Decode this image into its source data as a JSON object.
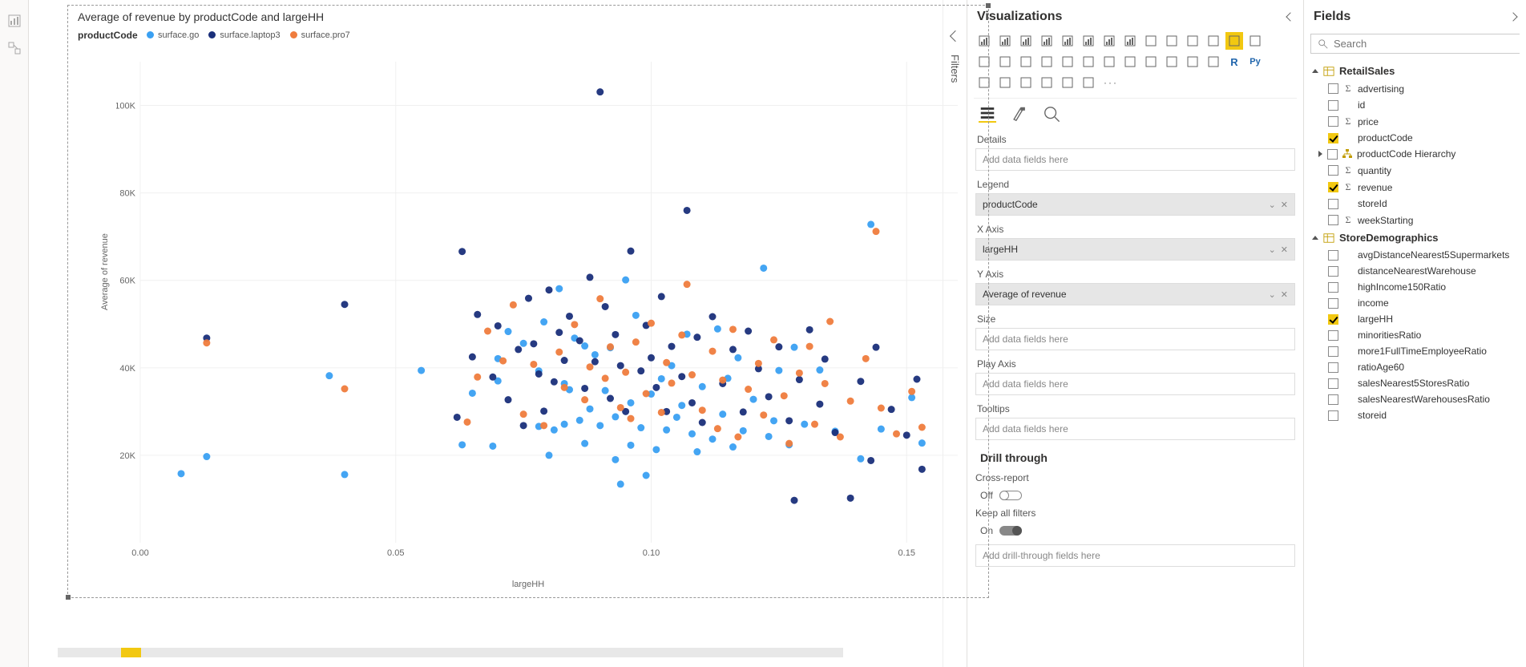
{
  "left_rail": {
    "icons": [
      "report-view-icon",
      "model-view-icon"
    ]
  },
  "filters_rail": {
    "label": "Filters"
  },
  "chart_data": {
    "type": "scatter",
    "title": "Average of revenue by productCode and largeHH",
    "legend_title": "productCode",
    "xlabel": "largeHH",
    "ylabel": "Average of revenue",
    "xlim": [
      0.0,
      0.16
    ],
    "ylim": [
      0,
      110000
    ],
    "xticks": [
      0.0,
      0.05,
      0.1,
      0.15
    ],
    "yticks": [
      20000,
      40000,
      60000,
      80000,
      100000
    ],
    "ytick_labels": [
      "20K",
      "40K",
      "60K",
      "80K",
      "100K"
    ],
    "series": [
      {
        "name": "surface.go",
        "color": "#3aa0f2",
        "points": [
          [
            0.008,
            15800
          ],
          [
            0.013,
            19700
          ],
          [
            0.04,
            15600
          ],
          [
            0.037,
            38200
          ],
          [
            0.055,
            39400
          ],
          [
            0.063,
            22400
          ],
          [
            0.065,
            34200
          ],
          [
            0.069,
            22100
          ],
          [
            0.07,
            37000
          ],
          [
            0.07,
            42100
          ],
          [
            0.072,
            48300
          ],
          [
            0.075,
            45600
          ],
          [
            0.078,
            39300
          ],
          [
            0.078,
            26600
          ],
          [
            0.079,
            50500
          ],
          [
            0.08,
            20000
          ],
          [
            0.081,
            25800
          ],
          [
            0.082,
            58100
          ],
          [
            0.083,
            27100
          ],
          [
            0.083,
            36400
          ],
          [
            0.084,
            35000
          ],
          [
            0.085,
            46800
          ],
          [
            0.086,
            28000
          ],
          [
            0.087,
            22700
          ],
          [
            0.087,
            45000
          ],
          [
            0.088,
            30600
          ],
          [
            0.089,
            43000
          ],
          [
            0.09,
            26800
          ],
          [
            0.091,
            34800
          ],
          [
            0.092,
            44600
          ],
          [
            0.093,
            28800
          ],
          [
            0.093,
            19000
          ],
          [
            0.094,
            13400
          ],
          [
            0.095,
            60100
          ],
          [
            0.096,
            32000
          ],
          [
            0.096,
            22300
          ],
          [
            0.097,
            52000
          ],
          [
            0.098,
            26300
          ],
          [
            0.099,
            15400
          ],
          [
            0.1,
            34000
          ],
          [
            0.101,
            21300
          ],
          [
            0.102,
            37500
          ],
          [
            0.103,
            25800
          ],
          [
            0.104,
            40500
          ],
          [
            0.105,
            28700
          ],
          [
            0.106,
            31400
          ],
          [
            0.107,
            47700
          ],
          [
            0.108,
            24900
          ],
          [
            0.109,
            20800
          ],
          [
            0.11,
            35700
          ],
          [
            0.112,
            23700
          ],
          [
            0.113,
            48900
          ],
          [
            0.114,
            29400
          ],
          [
            0.115,
            37600
          ],
          [
            0.116,
            21900
          ],
          [
            0.117,
            42300
          ],
          [
            0.118,
            25600
          ],
          [
            0.12,
            32800
          ],
          [
            0.122,
            62800
          ],
          [
            0.123,
            24300
          ],
          [
            0.124,
            27900
          ],
          [
            0.125,
            39400
          ],
          [
            0.127,
            22400
          ],
          [
            0.128,
            44700
          ],
          [
            0.13,
            27100
          ],
          [
            0.133,
            39500
          ],
          [
            0.136,
            25500
          ],
          [
            0.141,
            19200
          ],
          [
            0.143,
            72800
          ],
          [
            0.145,
            26000
          ],
          [
            0.151,
            33200
          ],
          [
            0.153,
            22800
          ]
        ]
      },
      {
        "name": "surface.laptop3",
        "color": "#1a2f7a",
        "points": [
          [
            0.013,
            46800
          ],
          [
            0.04,
            54500
          ],
          [
            0.062,
            28700
          ],
          [
            0.063,
            66600
          ],
          [
            0.065,
            42500
          ],
          [
            0.066,
            52200
          ],
          [
            0.069,
            37900
          ],
          [
            0.07,
            49600
          ],
          [
            0.072,
            32700
          ],
          [
            0.074,
            44200
          ],
          [
            0.075,
            26800
          ],
          [
            0.076,
            55900
          ],
          [
            0.077,
            45500
          ],
          [
            0.078,
            38600
          ],
          [
            0.079,
            30100
          ],
          [
            0.08,
            57800
          ],
          [
            0.081,
            36800
          ],
          [
            0.082,
            48100
          ],
          [
            0.083,
            41700
          ],
          [
            0.084,
            51800
          ],
          [
            0.086,
            46200
          ],
          [
            0.087,
            35300
          ],
          [
            0.088,
            60700
          ],
          [
            0.089,
            41400
          ],
          [
            0.09,
            103100
          ],
          [
            0.091,
            54000
          ],
          [
            0.092,
            33000
          ],
          [
            0.093,
            47600
          ],
          [
            0.094,
            40500
          ],
          [
            0.095,
            30000
          ],
          [
            0.096,
            66700
          ],
          [
            0.098,
            39300
          ],
          [
            0.099,
            49700
          ],
          [
            0.1,
            42300
          ],
          [
            0.101,
            35500
          ],
          [
            0.102,
            56300
          ],
          [
            0.103,
            30000
          ],
          [
            0.104,
            44900
          ],
          [
            0.106,
            38000
          ],
          [
            0.107,
            76000
          ],
          [
            0.108,
            32000
          ],
          [
            0.109,
            47000
          ],
          [
            0.11,
            27500
          ],
          [
            0.112,
            51700
          ],
          [
            0.114,
            36400
          ],
          [
            0.116,
            44200
          ],
          [
            0.118,
            29900
          ],
          [
            0.119,
            48400
          ],
          [
            0.121,
            39800
          ],
          [
            0.123,
            33400
          ],
          [
            0.125,
            44800
          ],
          [
            0.127,
            27900
          ],
          [
            0.128,
            9700
          ],
          [
            0.129,
            37300
          ],
          [
            0.131,
            48700
          ],
          [
            0.133,
            31700
          ],
          [
            0.134,
            42000
          ],
          [
            0.136,
            25200
          ],
          [
            0.139,
            10200
          ],
          [
            0.141,
            36900
          ],
          [
            0.143,
            18800
          ],
          [
            0.144,
            44700
          ],
          [
            0.147,
            30500
          ],
          [
            0.15,
            24600
          ],
          [
            0.152,
            37400
          ],
          [
            0.153,
            16800
          ]
        ]
      },
      {
        "name": "surface.pro7",
        "color": "#ef7c3d",
        "points": [
          [
            0.013,
            45700
          ],
          [
            0.04,
            35200
          ],
          [
            0.064,
            27600
          ],
          [
            0.066,
            37900
          ],
          [
            0.068,
            48400
          ],
          [
            0.071,
            41600
          ],
          [
            0.073,
            54400
          ],
          [
            0.075,
            29400
          ],
          [
            0.077,
            40800
          ],
          [
            0.079,
            26800
          ],
          [
            0.082,
            43600
          ],
          [
            0.083,
            35500
          ],
          [
            0.085,
            49900
          ],
          [
            0.087,
            32700
          ],
          [
            0.088,
            40200
          ],
          [
            0.09,
            55800
          ],
          [
            0.091,
            37600
          ],
          [
            0.092,
            44800
          ],
          [
            0.094,
            30900
          ],
          [
            0.095,
            39000
          ],
          [
            0.096,
            28400
          ],
          [
            0.097,
            45900
          ],
          [
            0.099,
            34100
          ],
          [
            0.1,
            50200
          ],
          [
            0.102,
            29800
          ],
          [
            0.103,
            41200
          ],
          [
            0.104,
            36500
          ],
          [
            0.106,
            47500
          ],
          [
            0.107,
            59100
          ],
          [
            0.108,
            38400
          ],
          [
            0.11,
            30300
          ],
          [
            0.112,
            43800
          ],
          [
            0.113,
            26100
          ],
          [
            0.114,
            37200
          ],
          [
            0.116,
            48800
          ],
          [
            0.117,
            24200
          ],
          [
            0.119,
            35100
          ],
          [
            0.121,
            41000
          ],
          [
            0.122,
            29200
          ],
          [
            0.124,
            46400
          ],
          [
            0.126,
            33600
          ],
          [
            0.127,
            22700
          ],
          [
            0.129,
            38800
          ],
          [
            0.131,
            44900
          ],
          [
            0.132,
            27100
          ],
          [
            0.134,
            36400
          ],
          [
            0.135,
            50600
          ],
          [
            0.137,
            24200
          ],
          [
            0.139,
            32400
          ],
          [
            0.142,
            42100
          ],
          [
            0.144,
            71200
          ],
          [
            0.145,
            30800
          ],
          [
            0.148,
            24900
          ],
          [
            0.151,
            34600
          ],
          [
            0.153,
            26400
          ]
        ]
      }
    ]
  },
  "viz_panel": {
    "title": "Visualizations",
    "selected_icon": "scatter-chart-icon",
    "more": "···",
    "tabs": {
      "fields_tab": "fields",
      "format_tab": "format",
      "analytics_tab": "analytics"
    },
    "wells": {
      "details": {
        "label": "Details",
        "placeholder": "Add data fields here"
      },
      "legend": {
        "label": "Legend",
        "value": "productCode"
      },
      "xaxis": {
        "label": "X Axis",
        "value": "largeHH"
      },
      "yaxis": {
        "label": "Y Axis",
        "value": "Average of revenue"
      },
      "size": {
        "label": "Size",
        "placeholder": "Add data fields here"
      },
      "playaxis": {
        "label": "Play Axis",
        "placeholder": "Add data fields here"
      },
      "tooltips": {
        "label": "Tooltips",
        "placeholder": "Add data fields here"
      }
    },
    "drill": {
      "title": "Drill through",
      "cross_label": "Cross-report",
      "cross_state": "Off",
      "keep_label": "Keep all filters",
      "keep_state": "On",
      "placeholder": "Add drill-through fields here"
    }
  },
  "fields_panel": {
    "title": "Fields",
    "search_placeholder": "Search",
    "tables": [
      {
        "name": "RetailSales",
        "expanded": true,
        "fields": [
          {
            "name": "advertising",
            "sigma": true,
            "checked": false
          },
          {
            "name": "id",
            "sigma": false,
            "checked": false
          },
          {
            "name": "price",
            "sigma": true,
            "checked": false
          },
          {
            "name": "productCode",
            "sigma": false,
            "checked": true
          },
          {
            "name": "productCode Hierarchy",
            "sigma": false,
            "checked": false,
            "hierarchy": true
          },
          {
            "name": "quantity",
            "sigma": true,
            "checked": false
          },
          {
            "name": "revenue",
            "sigma": true,
            "checked": true
          },
          {
            "name": "storeId",
            "sigma": false,
            "checked": false
          },
          {
            "name": "weekStarting",
            "sigma": true,
            "checked": false
          }
        ]
      },
      {
        "name": "StoreDemographics",
        "expanded": true,
        "fields": [
          {
            "name": "avgDistanceNearest5Supermarkets",
            "checked": false
          },
          {
            "name": "distanceNearestWarehouse",
            "checked": false
          },
          {
            "name": "highIncome150Ratio",
            "checked": false
          },
          {
            "name": "income",
            "checked": false
          },
          {
            "name": "largeHH",
            "checked": true
          },
          {
            "name": "minoritiesRatio",
            "checked": false
          },
          {
            "name": "more1FullTimeEmployeeRatio",
            "checked": false
          },
          {
            "name": "ratioAge60",
            "checked": false
          },
          {
            "name": "salesNearest5StoresRatio",
            "checked": false
          },
          {
            "name": "salesNearestWarehousesRatio",
            "checked": false
          },
          {
            "name": "storeid",
            "checked": false
          }
        ]
      }
    ]
  }
}
